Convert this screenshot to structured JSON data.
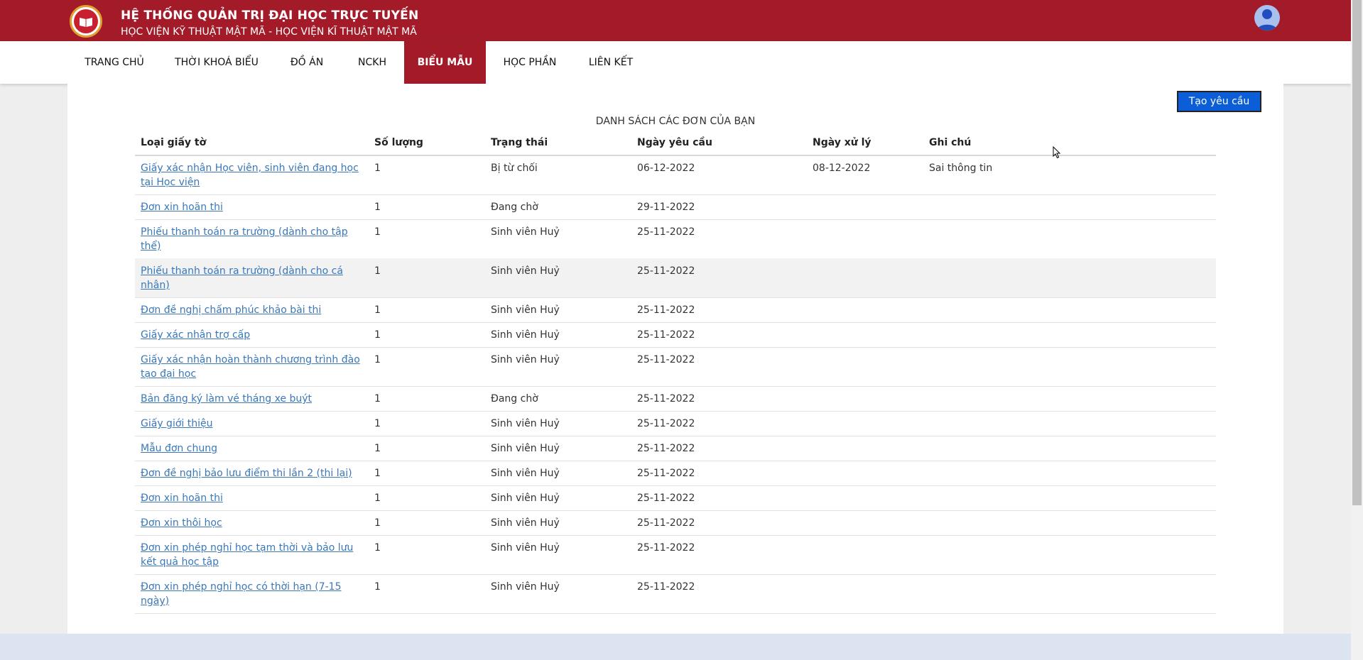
{
  "header": {
    "title": "HỆ THỐNG QUẢN TRỊ ĐẠI HỌC TRỰC TUYẾN",
    "subtitle": "HỌC VIỆN KỸ THUẬT MẬT MÃ - HỌC VIỆN KĨ THUẬT MẬT MÃ",
    "brand_color": "#a31b29"
  },
  "nav": {
    "items": [
      {
        "label": "TRANG CHỦ"
      },
      {
        "label": "THỜI KHOÁ BIỂU"
      },
      {
        "label": "ĐỒ ÁN"
      },
      {
        "label": "NCKH"
      },
      {
        "label": "BIỂU MẪU",
        "active": true
      },
      {
        "label": "HỌC PHẦN"
      },
      {
        "label": "LIÊN KẾT"
      }
    ]
  },
  "main": {
    "create_button": "Tạo yêu cầu",
    "list_title": "DANH SÁCH CÁC ĐƠN CỦA BẠN",
    "columns": [
      "Loại giấy tờ",
      "Số lượng",
      "Trạng thái",
      "Ngày yêu cầu",
      "Ngày xử lý",
      "Ghi chú"
    ],
    "rows": [
      {
        "type": "Giấy xác nhận Học viên, sinh viên đang học tại Học viện",
        "qty": "1",
        "status": "Bị từ chối",
        "requested": "06-12-2022",
        "processed": "08-12-2022",
        "note": "Sai thông tin"
      },
      {
        "type": "Đơn xin hoãn thi",
        "qty": "1",
        "status": "Đang chờ",
        "requested": "29-11-2022",
        "processed": "",
        "note": ""
      },
      {
        "type": "Phiếu thanh toán ra trường (dành cho tập thể)",
        "qty": "1",
        "status": "Sinh viên Huỷ",
        "requested": "25-11-2022",
        "processed": "",
        "note": ""
      },
      {
        "type": "Phiếu thanh toán ra trường (dành cho cá nhân)",
        "qty": "1",
        "status": "Sinh viên Huỷ",
        "requested": "25-11-2022",
        "processed": "",
        "note": ""
      },
      {
        "type": "Đơn đề nghị chấm phúc khảo bài thi",
        "qty": "1",
        "status": "Sinh viên Huỷ",
        "requested": "25-11-2022",
        "processed": "",
        "note": ""
      },
      {
        "type": "Giấy xác nhận trợ cấp",
        "qty": "1",
        "status": "Sinh viên Huỷ",
        "requested": "25-11-2022",
        "processed": "",
        "note": ""
      },
      {
        "type": "Giấy xác nhận hoàn thành chương trình đào tạo đại học",
        "qty": "1",
        "status": "Sinh viên Huỷ",
        "requested": "25-11-2022",
        "processed": "",
        "note": ""
      },
      {
        "type": "Bản đăng ký làm vé tháng xe buýt",
        "qty": "1",
        "status": "Đang chờ",
        "requested": "25-11-2022",
        "processed": "",
        "note": ""
      },
      {
        "type": "Giấy giới thiệu",
        "qty": "1",
        "status": "Sinh viên Huỷ",
        "requested": "25-11-2022",
        "processed": "",
        "note": ""
      },
      {
        "type": "Mẫu đơn chung",
        "qty": "1",
        "status": "Sinh viên Huỷ",
        "requested": "25-11-2022",
        "processed": "",
        "note": ""
      },
      {
        "type": "Đơn đề nghị bảo lưu điểm thi lần 2 (thi lại)",
        "qty": "1",
        "status": "Sinh viên Huỷ",
        "requested": "25-11-2022",
        "processed": "",
        "note": ""
      },
      {
        "type": "Đơn xin hoãn thi",
        "qty": "1",
        "status": "Sinh viên Huỷ",
        "requested": "25-11-2022",
        "processed": "",
        "note": ""
      },
      {
        "type": "Đơn xin thôi học",
        "qty": "1",
        "status": "Sinh viên Huỷ",
        "requested": "25-11-2022",
        "processed": "",
        "note": ""
      },
      {
        "type": "Đơn xin phép nghỉ học tạm thời và bảo lưu kết quả học tập",
        "qty": "1",
        "status": "Sinh viên Huỷ",
        "requested": "25-11-2022",
        "processed": "",
        "note": ""
      },
      {
        "type": "Đơn xin phép nghỉ học có thời hạn (7-15 ngày)",
        "qty": "1",
        "status": "Sinh viên Huỷ",
        "requested": "25-11-2022",
        "processed": "",
        "note": ""
      }
    ]
  }
}
